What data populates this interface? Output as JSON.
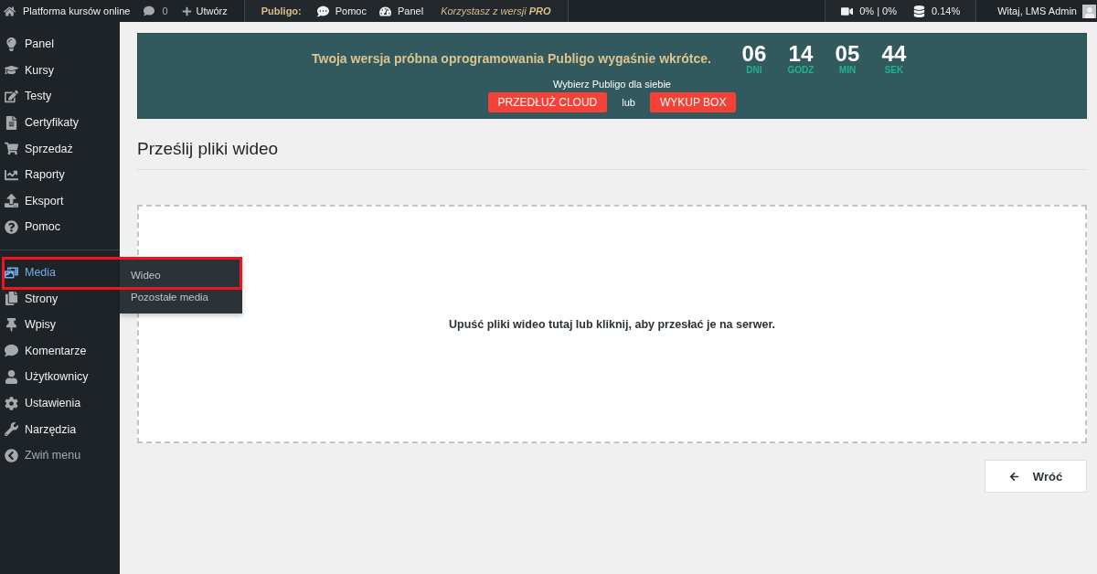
{
  "admin_bar": {
    "site_name": "Platforma kursów online",
    "comments_count": "0",
    "new_label": "Utwórz",
    "plugin": {
      "name": "Publigo:",
      "links": [
        "Pomoc",
        "Panel"
      ],
      "license_note": "Korzystasz z wersji **PRO**"
    },
    "stats": [
      "0% | 0%",
      "0.14%"
    ],
    "greeting": "Witaj, LMS Admin"
  },
  "sidebar": {
    "sections": [
      {
        "items": [
          {
            "label": "Panel",
            "selected": false,
            "highlighted": false
          },
          {
            "label": "Kursy",
            "selected": false,
            "highlighted": false
          },
          {
            "label": "Testy",
            "selected": false,
            "highlighted": false
          },
          {
            "label": "Certyfikaty",
            "selected": false,
            "highlighted": false
          },
          {
            "label": "Sprzedaż",
            "selected": false,
            "highlighted": false
          },
          {
            "label": "Raporty",
            "selected": false,
            "highlighted": false
          },
          {
            "label": "Eksport",
            "selected": false,
            "highlighted": false
          },
          {
            "label": "Pomoc",
            "selected": false,
            "highlighted": false
          }
        ]
      },
      {
        "items": [
          {
            "label": "Media",
            "selected": true,
            "highlighted": true,
            "submenu": [
              "Wideo",
              "Pozostałe media"
            ]
          },
          {
            "label": "Strony",
            "selected": false,
            "highlighted": false
          },
          {
            "label": "Wpisy",
            "selected": false,
            "highlighted": false
          },
          {
            "label": "Komentarze",
            "selected": false,
            "highlighted": false
          },
          {
            "label": "Użytkownicy",
            "selected": false,
            "highlighted": false
          },
          {
            "label": "Ustawienia",
            "selected": false,
            "highlighted": false
          },
          {
            "label": "Narzędzia",
            "selected": false,
            "highlighted": false
          }
        ]
      }
    ],
    "collapse_label": "Zwiń menu"
  },
  "trial_banner": {
    "message": "Twoja wersja próbna oprogramowania Publigo wygaśnie wkrótce.",
    "countdown": [
      {
        "value": "06",
        "unit": "DNI"
      },
      {
        "value": "14",
        "unit": "GODZ"
      },
      {
        "value": "05",
        "unit": "MIN"
      },
      {
        "value": "44",
        "unit": "SEK"
      }
    ],
    "prompt": "Wybierz Publigo dla siebie",
    "buttons": [
      "PRZEDŁUŻ CLOUD",
      "WYKUP BOX"
    ],
    "separator": "lub"
  },
  "page": {
    "title": "Prześlij pliki wideo",
    "drop_zone": "Upuść pliki wideo tutaj lub kliknij, aby przesłać je na serwer.",
    "back_button": "Wróć"
  }
}
